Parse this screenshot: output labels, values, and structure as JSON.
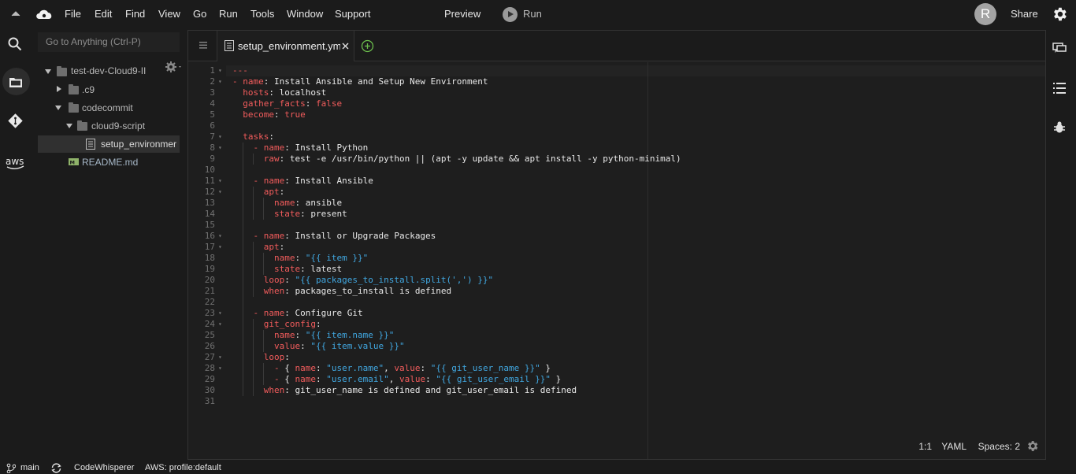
{
  "menubar": {
    "menus": [
      "File",
      "Edit",
      "Find",
      "View",
      "Go",
      "Run",
      "Tools",
      "Window",
      "Support"
    ],
    "preview_label": "Preview",
    "run_label": "Run",
    "avatar_initial": "R",
    "share_label": "Share"
  },
  "sidebar": {
    "goto_placeholder": "Go to Anything (Ctrl-P)",
    "tree": [
      {
        "label": "test-dev-Cloud9-II",
        "type": "folder",
        "expanded": true
      },
      {
        "label": ".c9",
        "type": "folder",
        "expanded": false
      },
      {
        "label": "codecommit",
        "type": "folder",
        "expanded": true
      },
      {
        "label": "cloud9-script",
        "type": "folder",
        "expanded": true
      },
      {
        "label": "setup_environmer",
        "type": "file",
        "selected": true
      },
      {
        "label": "README.md",
        "type": "markdown"
      }
    ]
  },
  "editor": {
    "tab_label": "setup_environment.ym",
    "lines": [
      {
        "n": "1",
        "fold": true,
        "html": "<span class='d'>---</span>"
      },
      {
        "n": "2",
        "fold": true,
        "html": "<span class='b'>-</span> <span class='k'>name</span>: Install Ansible and Setup New Environment"
      },
      {
        "n": "3",
        "fold": false,
        "html": "  <span class='k'>hosts</span>: localhost"
      },
      {
        "n": "4",
        "fold": false,
        "html": "  <span class='k'>gather_facts</span>: <span class='k'>false</span>"
      },
      {
        "n": "5",
        "fold": false,
        "html": "  <span class='k'>become</span>: <span class='k'>true</span>"
      },
      {
        "n": "6",
        "fold": false,
        "html": ""
      },
      {
        "n": "7",
        "fold": true,
        "html": "  <span class='k'>tasks</span>:"
      },
      {
        "n": "8",
        "fold": true,
        "html": "    <span class='b'>-</span> <span class='k'>name</span>: Install Python"
      },
      {
        "n": "9",
        "fold": false,
        "html": "      <span class='k'>raw</span>: test -e /usr/bin/python || (apt -y update &amp;&amp; apt install -y python-minimal)"
      },
      {
        "n": "10",
        "fold": false,
        "html": ""
      },
      {
        "n": "11",
        "fold": true,
        "html": "    <span class='b'>-</span> <span class='k'>name</span>: Install Ansible"
      },
      {
        "n": "12",
        "fold": true,
        "html": "      <span class='k'>apt</span>:"
      },
      {
        "n": "13",
        "fold": false,
        "html": "        <span class='k'>name</span>: ansible"
      },
      {
        "n": "14",
        "fold": false,
        "html": "        <span class='k'>state</span>: present"
      },
      {
        "n": "15",
        "fold": false,
        "html": ""
      },
      {
        "n": "16",
        "fold": true,
        "html": "    <span class='b'>-</span> <span class='k'>name</span>: Install or Upgrade Packages"
      },
      {
        "n": "17",
        "fold": true,
        "html": "      <span class='k'>apt</span>:"
      },
      {
        "n": "18",
        "fold": false,
        "html": "        <span class='k'>name</span>: <span class='s'>\"{{ item }}\"</span>"
      },
      {
        "n": "19",
        "fold": false,
        "html": "        <span class='k'>state</span>: latest"
      },
      {
        "n": "20",
        "fold": false,
        "html": "      <span class='k'>loop</span>: <span class='s'>\"{{ packages_to_install.split(',') }}\"</span>"
      },
      {
        "n": "21",
        "fold": false,
        "html": "      <span class='k'>when</span>: packages_to_install is defined"
      },
      {
        "n": "22",
        "fold": false,
        "html": ""
      },
      {
        "n": "23",
        "fold": true,
        "html": "    <span class='b'>-</span> <span class='k'>name</span>: Configure Git"
      },
      {
        "n": "24",
        "fold": true,
        "html": "      <span class='k'>git_config</span>:"
      },
      {
        "n": "25",
        "fold": false,
        "html": "        <span class='k'>name</span>: <span class='s'>\"{{ item.name }}\"</span>"
      },
      {
        "n": "26",
        "fold": false,
        "html": "        <span class='k'>value</span>: <span class='s'>\"{{ item.value }}\"</span>"
      },
      {
        "n": "27",
        "fold": true,
        "html": "      <span class='k'>loop</span>:"
      },
      {
        "n": "28",
        "fold": true,
        "html": "        <span class='b'>-</span> { <span class='k'>name</span>: <span class='s'>\"user.name\"</span>, <span class='k'>value</span>: <span class='s'>\"{{ git_user_name }}\"</span> }"
      },
      {
        "n": "29",
        "fold": false,
        "html": "        <span class='b'>-</span> { <span class='k'>name</span>: <span class='s'>\"user.email\"</span>, <span class='k'>value</span>: <span class='s'>\"{{ git_user_email }}\"</span> }"
      },
      {
        "n": "30",
        "fold": false,
        "html": "      <span class='k'>when</span>: git_user_name is defined and git_user_email is defined"
      },
      {
        "n": "31",
        "fold": false,
        "html": ""
      }
    ],
    "status": {
      "cursor": "1:1",
      "mode": "YAML",
      "indent": "Spaces: 2"
    }
  },
  "bottombar": {
    "branch": "main",
    "codewhisperer": "CodeWhisperer",
    "aws_profile": "AWS: profile:default"
  },
  "colors": {
    "keyword": "#f25c5c",
    "string": "#41a7e0",
    "background": "#1b1b1b"
  }
}
